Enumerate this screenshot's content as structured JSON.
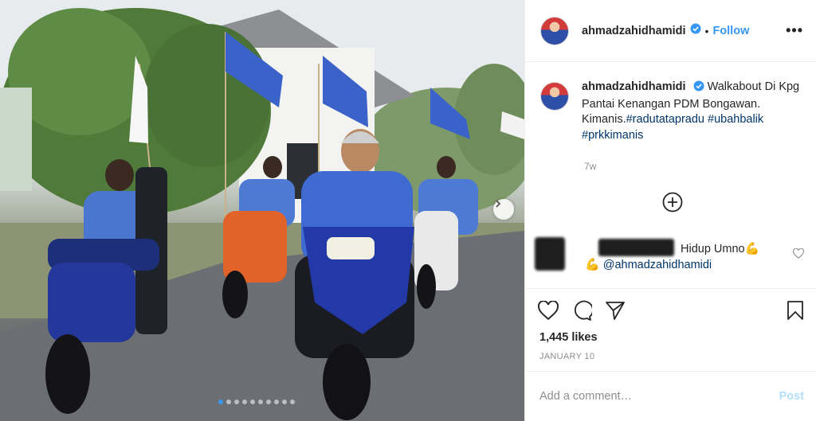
{
  "post": {
    "username": "ahmadzahidhamidi",
    "separator": "•",
    "follow_label": "Follow",
    "more_label": "•••",
    "caption_text": "Walkabout Di Kpg Pantai Kenangan PDM Bongawan. Kimanis.",
    "hashtags": [
      "#radutatapradu",
      "#ubahbalik",
      "#prkkimanis"
    ],
    "time_ago": "7w",
    "likes": "1,445 likes",
    "date": "JANUARY 10"
  },
  "comment": {
    "text": "Hidup Umno",
    "emoji": "💪",
    "mention": "@ahmadzahidhamidi"
  },
  "add_comment": {
    "placeholder": "Add a comment…",
    "post_label": "Post"
  },
  "carousel": {
    "dot_count": 10,
    "active_index": 0
  },
  "icons": {
    "verified": "verified-badge-icon",
    "load_more": "plus-circle-icon",
    "like": "heart-icon",
    "comment": "comment-bubble-icon",
    "share": "paper-plane-icon",
    "save": "bookmark-icon",
    "next": "chevron-right-icon"
  },
  "colors": {
    "link": "#3897f0",
    "hashtag": "#003569",
    "muted": "#8e8e8e",
    "post_disabled": "#b2dffc"
  }
}
